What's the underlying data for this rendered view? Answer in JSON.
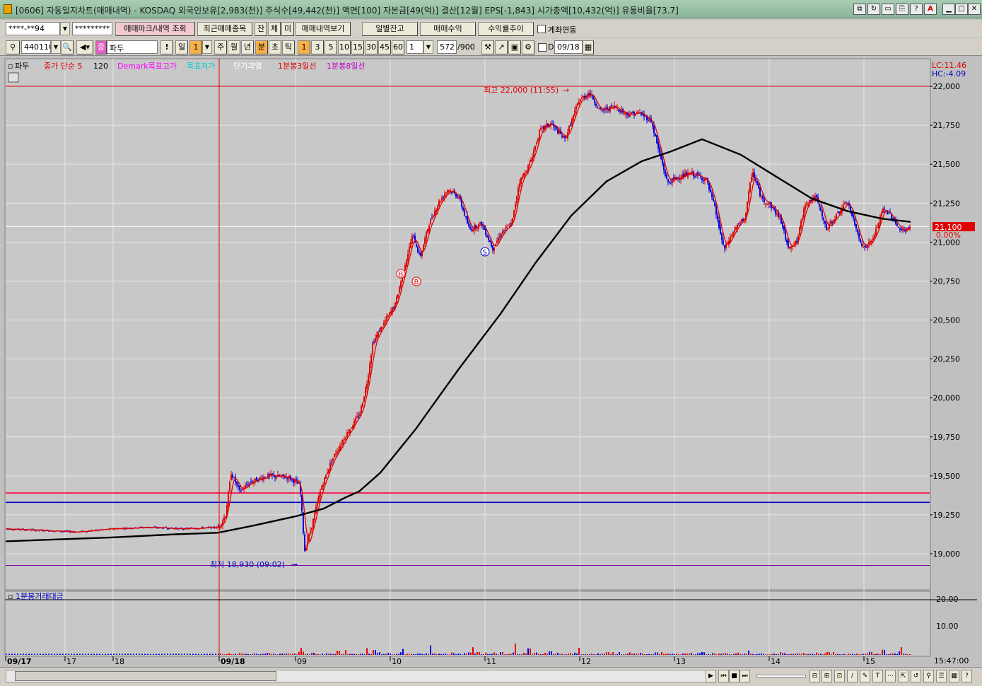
{
  "window": {
    "title": "[0606] 자동일지차트(매매내역) - KOSDAQ 외국인보유[2,983(천)] 주식수[49,442(천)] 액면[100] 자본금[49(억)] 결산[12월] EPS[-1,843] 시가총액[10,432(억)] 유통비율[73.7]"
  },
  "toolbar1": {
    "account": "****-**94",
    "password": "*********",
    "query_button": "매매마크/내역 조회",
    "recent_button": "최근매매종목",
    "jan_button": "잔",
    "che_button": "체",
    "mi_button": "미",
    "history_button": "매매내역보기",
    "daily_balance_button": "일별잔고",
    "profit_button": "매매수익",
    "yield_button": "수익률추이",
    "account_link_label": "계좌연동"
  },
  "toolbar2": {
    "code": "440110",
    "stock_name": "파두",
    "stock_badge": "증",
    "exclaim": "!",
    "period_labels": [
      "일",
      "1"
    ],
    "period_buttons": [
      "주",
      "월",
      "년",
      "분",
      "초",
      "틱"
    ],
    "minute_buttons": [
      "1",
      "3",
      "5",
      "10",
      "15",
      "30",
      "45",
      "60"
    ],
    "custom_minute": "1",
    "count_value": "572",
    "count_total": "/900",
    "date_check_label": "D",
    "date_value": "09/18"
  },
  "legend": {
    "items": [
      {
        "text": "파두",
        "color": "#000000"
      },
      {
        "text": "종가 단순 5",
        "color": "#e00000"
      },
      {
        "text": "120",
        "color": "#000000"
      },
      {
        "text": "Demark목표고가",
        "color": "#ff00ff"
      },
      {
        "text": "목표저가",
        "color": "#00d0d0"
      },
      {
        "text": "단기과열",
        "color": "#ffffff"
      },
      {
        "text": "1분봉3일선",
        "color": "#e00000"
      },
      {
        "text": "1분봉8일선",
        "color": "#c000c0"
      }
    ],
    "lc": "LC:11.46",
    "hc": "HC:-4.09"
  },
  "annotations": {
    "high": "최고 22,000 (11:55)",
    "low": "최저 18,930 (09:02)",
    "current_price": "21,100",
    "current_change": "0.00%",
    "buy_mark": "B",
    "sell_mark": "S"
  },
  "volume_panel": {
    "title": "1분봉거래대금",
    "ticks": [
      "20.00",
      "10.00"
    ]
  },
  "chart_data": {
    "type": "candlestick",
    "ylim": [
      18800,
      22050
    ],
    "ytick_labels": [
      "22,000",
      "21,750",
      "21,500",
      "21,250",
      "21,000",
      "20,750",
      "20,500",
      "20,250",
      "20,000",
      "19,750",
      "19,500",
      "19,250",
      "19,000"
    ],
    "xtick_labels": [
      "09/17",
      "17",
      "18",
      "09/18",
      "09",
      "10",
      "11",
      "12",
      "13",
      "14",
      "15"
    ],
    "time_label": "15:47:00",
    "horizontal_lines": [
      {
        "price": 22000,
        "color": "#e00000"
      },
      {
        "price": 21100,
        "color": "#ffffff"
      },
      {
        "price": 19390,
        "color": "#ff0040"
      },
      {
        "price": 19330,
        "color": "#0000c0"
      },
      {
        "price": 18925,
        "color": "#8000a0"
      }
    ],
    "ma120": [
      [
        0,
        19080
      ],
      [
        60,
        19090
      ],
      [
        150,
        19105
      ],
      [
        240,
        19125
      ],
      [
        300,
        19135
      ],
      [
        350,
        19180
      ],
      [
        410,
        19240
      ],
      [
        450,
        19290
      ],
      [
        480,
        19360
      ],
      [
        500,
        19400
      ],
      [
        530,
        19520
      ],
      [
        580,
        19800
      ],
      [
        640,
        20180
      ],
      [
        700,
        20540
      ],
      [
        750,
        20870
      ],
      [
        800,
        21170
      ],
      [
        850,
        21390
      ],
      [
        900,
        21520
      ],
      [
        940,
        21580
      ],
      [
        985,
        21660
      ],
      [
        1040,
        21560
      ],
      [
        1090,
        21420
      ],
      [
        1140,
        21280
      ],
      [
        1190,
        21200
      ],
      [
        1240,
        21150
      ],
      [
        1280,
        21130
      ]
    ],
    "price_path": [
      [
        0,
        19160
      ],
      [
        50,
        19150
      ],
      [
        100,
        19140
      ],
      [
        150,
        19160
      ],
      [
        200,
        19170
      ],
      [
        250,
        19160
      ],
      [
        300,
        19170
      ],
      [
        310,
        19250
      ],
      [
        318,
        19520
      ],
      [
        330,
        19400
      ],
      [
        345,
        19460
      ],
      [
        370,
        19500
      ],
      [
        400,
        19490
      ],
      [
        415,
        19440
      ],
      [
        422,
        19020
      ],
      [
        432,
        19180
      ],
      [
        445,
        19420
      ],
      [
        460,
        19600
      ],
      [
        480,
        19760
      ],
      [
        500,
        19900
      ],
      [
        510,
        20100
      ],
      [
        518,
        20350
      ],
      [
        530,
        20450
      ],
      [
        550,
        20600
      ],
      [
        565,
        20880
      ],
      [
        575,
        21050
      ],
      [
        585,
        20900
      ],
      [
        598,
        21120
      ],
      [
        612,
        21260
      ],
      [
        625,
        21340
      ],
      [
        640,
        21290
      ],
      [
        655,
        21080
      ],
      [
        672,
        21120
      ],
      [
        688,
        20960
      ],
      [
        700,
        21060
      ],
      [
        715,
        21120
      ],
      [
        725,
        21380
      ],
      [
        740,
        21500
      ],
      [
        755,
        21720
      ],
      [
        770,
        21760
      ],
      [
        790,
        21660
      ],
      [
        810,
        21910
      ],
      [
        825,
        21960
      ],
      [
        840,
        21840
      ],
      [
        860,
        21870
      ],
      [
        878,
        21820
      ],
      [
        895,
        21830
      ],
      [
        912,
        21780
      ],
      [
        922,
        21600
      ],
      [
        935,
        21380
      ],
      [
        952,
        21420
      ],
      [
        970,
        21440
      ],
      [
        990,
        21400
      ],
      [
        1002,
        21220
      ],
      [
        1015,
        20950
      ],
      [
        1030,
        21080
      ],
      [
        1045,
        21160
      ],
      [
        1055,
        21460
      ],
      [
        1068,
        21280
      ],
      [
        1080,
        21240
      ],
      [
        1095,
        21150
      ],
      [
        1105,
        20970
      ],
      [
        1118,
        21000
      ],
      [
        1130,
        21250
      ],
      [
        1145,
        21290
      ],
      [
        1160,
        21080
      ],
      [
        1175,
        21180
      ],
      [
        1190,
        21260
      ],
      [
        1200,
        21110
      ],
      [
        1212,
        20960
      ],
      [
        1225,
        21010
      ],
      [
        1240,
        21210
      ],
      [
        1250,
        21180
      ],
      [
        1265,
        21070
      ],
      [
        1278,
        21090
      ]
    ],
    "volume_bars": [
      [
        315,
        0.6
      ],
      [
        330,
        0.8
      ],
      [
        370,
        0.7
      ],
      [
        418,
        1.2
      ],
      [
        470,
        1.5
      ],
      [
        480,
        1.8
      ],
      [
        510,
        2.5
      ],
      [
        520,
        1.8
      ],
      [
        560,
        1.0
      ],
      [
        600,
        1.6
      ],
      [
        660,
        1.3
      ],
      [
        700,
        1.0
      ],
      [
        720,
        4.2
      ],
      [
        740,
        2.4
      ],
      [
        770,
        1.3
      ],
      [
        810,
        1.2
      ],
      [
        850,
        1.0
      ],
      [
        920,
        0.9
      ],
      [
        980,
        0.6
      ],
      [
        1050,
        1.6
      ],
      [
        1100,
        0.6
      ],
      [
        1160,
        0.5
      ],
      [
        1220,
        0.5
      ],
      [
        1240,
        1.9
      ],
      [
        1265,
        1.3
      ]
    ]
  }
}
